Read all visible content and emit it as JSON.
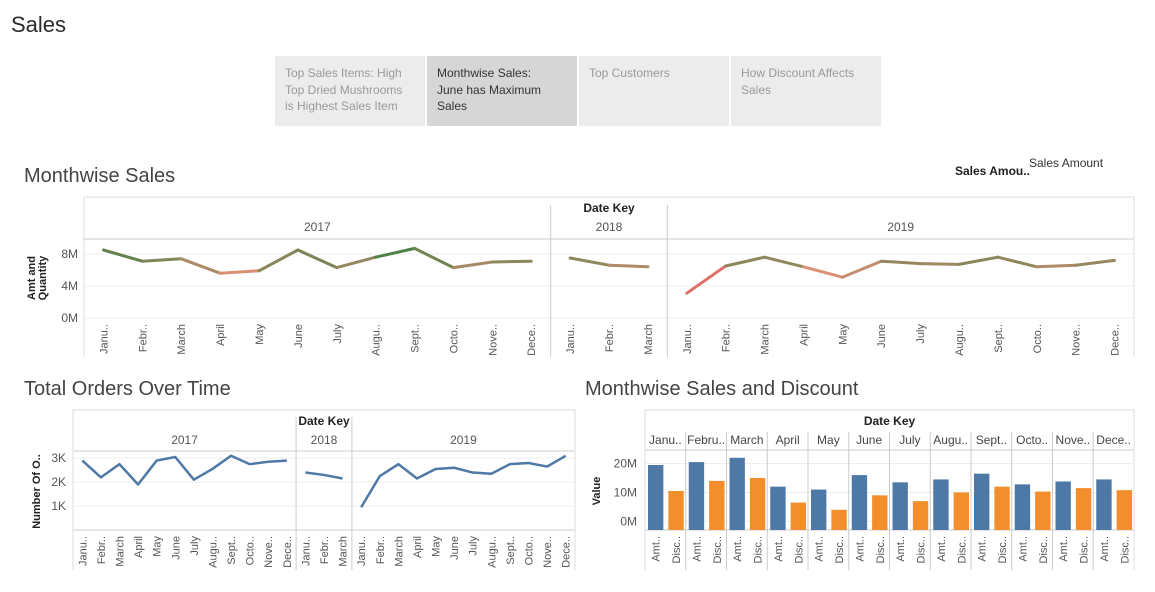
{
  "page": {
    "title": "Sales"
  },
  "tabs": [
    {
      "label": "Top Sales Items: High Top Dried Mushrooms is Highest Sales Item",
      "lines": [
        "Top Sales Items: High",
        "Top Dried Mushrooms",
        "is Highest Sales Item"
      ],
      "active": false
    },
    {
      "label": "Monthwise Sales: June has Maximum Sales",
      "lines": [
        "Monthwise Sales:",
        "June has Maximum",
        "Sales"
      ],
      "active": true
    },
    {
      "label": "Top Customers",
      "lines": [
        "Top Customers"
      ],
      "active": false
    },
    {
      "label": "How Discount Affects Sales",
      "lines": [
        "How Discount Affects",
        "Sales"
      ],
      "active": false
    }
  ],
  "legend": {
    "short_label": "Sales Amou..",
    "full_label": "Sales Amount"
  },
  "colors": {
    "line_high": "#2f7d3c",
    "line_low": "#e8907a",
    "line_min": "#c0243a",
    "orders_line": "#4e79a7",
    "bar_amount": "#4e79a7",
    "bar_discount": "#f28e2b"
  },
  "chart_data": [
    {
      "type": "line",
      "title": "Monthwise Sales",
      "column_header": "Date Key",
      "ylabel": "Amt and Quantity",
      "yticks": [
        "0M",
        "4M",
        "8M"
      ],
      "ylim": [
        0,
        10
      ],
      "unit": "M",
      "panels": [
        {
          "year": "2017",
          "months": [
            "Janu..",
            "Febr..",
            "March",
            "April",
            "May",
            "June",
            "July",
            "Augu..",
            "Sept..",
            "Octo..",
            "Nove..",
            "Dece.."
          ],
          "values": [
            8.5,
            7.1,
            7.4,
            5.6,
            5.9,
            8.5,
            6.3,
            7.6,
            8.7,
            6.3,
            7.0,
            7.1
          ]
        },
        {
          "year": "2018",
          "months": [
            "Janu..",
            "Febr..",
            "March"
          ],
          "values": [
            7.5,
            6.6,
            6.4
          ]
        },
        {
          "year": "2019",
          "months": [
            "Janu..",
            "Febr..",
            "March",
            "April",
            "May",
            "June",
            "July",
            "Augu..",
            "Sept..",
            "Octo..",
            "Nove..",
            "Dece.."
          ],
          "values": [
            3.1,
            6.5,
            7.6,
            6.4,
            5.1,
            7.1,
            6.8,
            6.7,
            7.6,
            6.4,
            6.6,
            7.2
          ]
        }
      ]
    },
    {
      "type": "line",
      "title": "Total Orders Over Time",
      "column_header": "Date Key",
      "ylabel": "Number Of O..",
      "yticks": [
        "1K",
        "2K",
        "3K"
      ],
      "ylim": [
        0,
        3.3
      ],
      "unit": "K",
      "panels": [
        {
          "year": "2017",
          "months": [
            "Janu..",
            "Febr..",
            "March",
            "April",
            "May",
            "June",
            "July",
            "Augu..",
            "Sept..",
            "Octo..",
            "Nove..",
            "Dece.."
          ],
          "values": [
            2.9,
            2.2,
            2.75,
            1.9,
            2.9,
            3.05,
            2.1,
            2.55,
            3.1,
            2.75,
            2.85,
            2.9
          ]
        },
        {
          "year": "2018",
          "months": [
            "Janu..",
            "Febr..",
            "March"
          ],
          "values": [
            2.4,
            2.3,
            2.15
          ]
        },
        {
          "year": "2019",
          "months": [
            "Janu..",
            "Febr..",
            "March",
            "April",
            "May",
            "June",
            "July",
            "Augu..",
            "Sept..",
            "Octo..",
            "Nove..",
            "Dece.."
          ],
          "values": [
            0.95,
            2.25,
            2.75,
            2.15,
            2.55,
            2.6,
            2.4,
            2.35,
            2.75,
            2.8,
            2.65,
            3.1
          ]
        }
      ]
    },
    {
      "type": "bar",
      "title": "Monthwise Sales and Discount",
      "column_header": "Date Key",
      "ylabel": "Value",
      "yticks": [
        "0M",
        "10M",
        "20M"
      ],
      "ylim": [
        -3,
        24
      ],
      "unit": "M",
      "categories": [
        "Janu..",
        "Febru..",
        "March",
        "April",
        "May",
        "June",
        "July",
        "Augu..",
        "Sept..",
        "Octo..",
        "Nove..",
        "Dece.."
      ],
      "bar_labels": [
        "Amt..",
        "Disc.."
      ],
      "series": [
        {
          "name": "Amt..",
          "values": [
            19.5,
            20.5,
            22.0,
            12.0,
            11.0,
            16.0,
            13.5,
            14.5,
            16.5,
            12.8,
            13.8,
            14.5
          ]
        },
        {
          "name": "Disc..",
          "values": [
            10.5,
            14.0,
            15.0,
            6.5,
            4.0,
            9.0,
            7.0,
            10.0,
            12.0,
            10.3,
            11.5,
            10.8
          ]
        }
      ]
    }
  ]
}
